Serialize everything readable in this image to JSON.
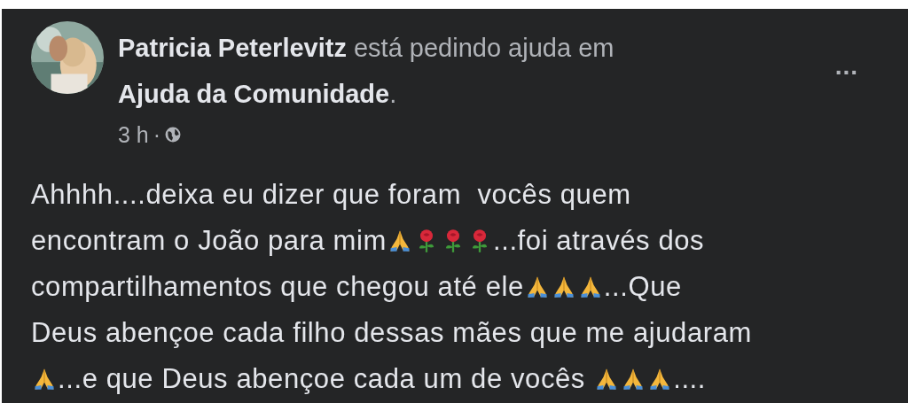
{
  "post": {
    "author": "Patricia Peterlevitz",
    "action": "está pedindo ajuda em",
    "group": "Ajuda da Comunidade",
    "punctuation": ".",
    "time": "3 h",
    "separator": "·",
    "menu": "...",
    "avatar": {
      "kind": "picture"
    },
    "body_lines": [
      [
        {
          "kind": "text",
          "text": "Ahhhh....deixa eu dizer que foram  vocês quem"
        }
      ],
      [
        {
          "kind": "text",
          "text": "encontram o João para mim"
        },
        {
          "kind": "pray"
        },
        {
          "kind": "rose"
        },
        {
          "kind": "rose"
        },
        {
          "kind": "rose"
        },
        {
          "kind": "text",
          "text": "...foi através dos"
        }
      ],
      [
        {
          "kind": "text",
          "text": "compartilhamentos que chegou até ele"
        },
        {
          "kind": "pray"
        },
        {
          "kind": "pray"
        },
        {
          "kind": "pray"
        },
        {
          "kind": "text",
          "text": "...Que"
        }
      ],
      [
        {
          "kind": "text",
          "text": "Deus abençoe cada filho dessas mães que me ajudaram"
        }
      ],
      [
        {
          "kind": "pray"
        },
        {
          "kind": "text",
          "text": "...e que Deus abençoe cada um de vocês "
        },
        {
          "kind": "pray"
        },
        {
          "kind": "pray"
        },
        {
          "kind": "pray"
        },
        {
          "kind": "text",
          "text": "...."
        }
      ]
    ]
  }
}
